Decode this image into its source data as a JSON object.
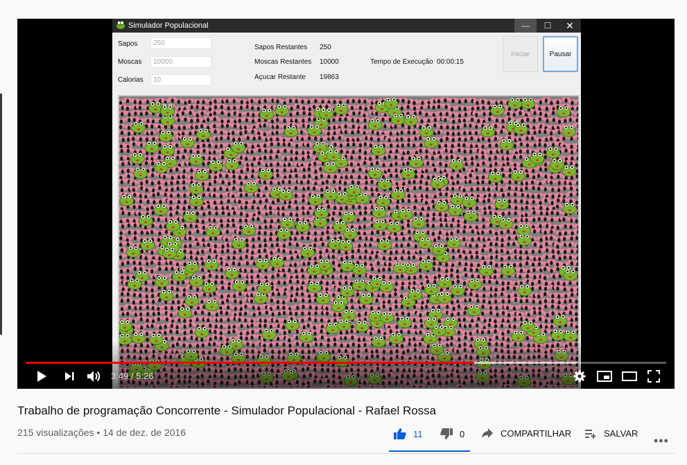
{
  "app": {
    "window_title": "Simulador Populacional",
    "fields": [
      {
        "label": "Sapos",
        "value": "250"
      },
      {
        "label": "Moscas",
        "value": "10000"
      },
      {
        "label": "Calorias",
        "value": "10"
      }
    ],
    "stats": {
      "sapos_label": "Sapos Restantes",
      "sapos_value": "250",
      "moscas_label": "Moscas Restantes",
      "moscas_value": "10000",
      "acucar_label": "Açucar Restante",
      "acucar_value": "19863",
      "tempo_label": "Tempo de Execução",
      "tempo_value": "00:00:15"
    },
    "buttons": {
      "start": "Iniciar",
      "pause": "Pausar"
    }
  },
  "player": {
    "time": "3:49 / 5:26",
    "played_fraction": 0.7,
    "loaded_fraction": 0.86
  },
  "video": {
    "title": "Trabalho de programação Concorrente - Simulador Populacional - Rafael Rossa",
    "views": "215 visualizações",
    "separator": "•",
    "date": "14 de dez. de 2016",
    "likes": "11",
    "dislikes": "0",
    "share_label": "COMPARTILHAR",
    "save_label": "SALVAR",
    "like_fraction": 1.0
  },
  "colors": {
    "progress": "#ff0000",
    "like": "#065fd4",
    "frog": "#7bb52c",
    "fly": "#e8849c"
  }
}
